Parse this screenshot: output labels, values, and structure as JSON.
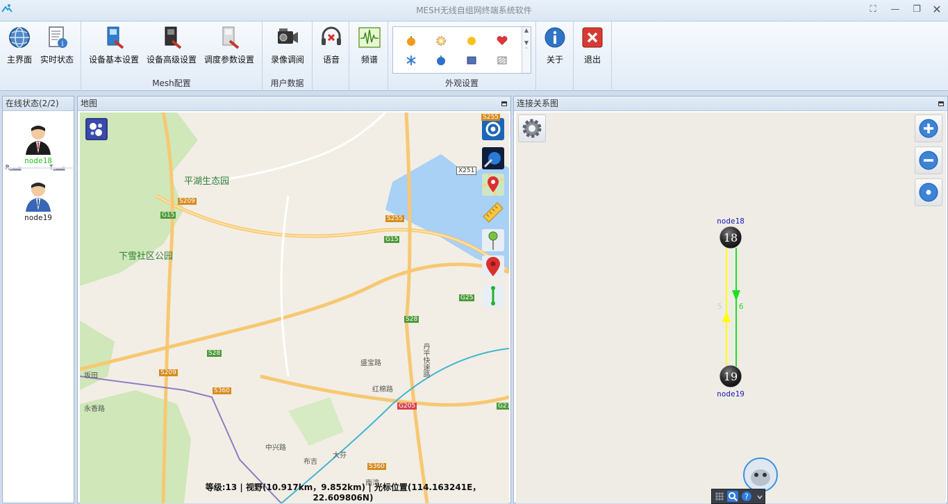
{
  "window": {
    "title": "MESH无线自组网终端系统软件"
  },
  "ribbon": {
    "groups": {
      "mesh_config": "Mesh配置",
      "user_data": "用户数据",
      "appearance": "外观设置"
    },
    "buttons": {
      "home": "主界面",
      "realtime": "实时状态",
      "basic_settings": "设备基本设置",
      "advanced_settings": "设备高级设置",
      "schedule_params": "调度参数设置",
      "recording": "录像调阅",
      "voice": "语音",
      "spectrum": "频谱",
      "about": "关于",
      "exit": "退出"
    }
  },
  "online_panel": {
    "title": "在线状态(2/2)",
    "nodes": [
      {
        "name": "node18",
        "color": "#22c322",
        "rx_label": "R",
        "tx_label": "T"
      },
      {
        "name": "node19",
        "color": "#111111"
      }
    ]
  },
  "map_panel": {
    "title": "地图",
    "status": "等级:13 | 视野(10.917km，9.852km) | 光标位置(114.163241E，22.609806N)",
    "labels": {
      "pinghu": "平湖生态园",
      "xiaxue": "下雪社区公园",
      "s209a": "S209",
      "s209b": "S209",
      "g15a": "G15",
      "g15b": "G15",
      "s255a": "S255",
      "s255b": "S255",
      "x251": "X251",
      "g25": "G25",
      "s28a": "S28",
      "s28b": "S28",
      "s360a": "S360",
      "s360b": "S360",
      "g205": "G205",
      "g21": "G21",
      "bantian": "坂田",
      "yongxiang": "永香路",
      "shengbao": "盛宝路",
      "hongmian": "红棉路",
      "zhongxing": "中兴路",
      "buji": "布吉",
      "dafen": "大芬",
      "nanwan": "南湾",
      "danping": "丹平快速路"
    }
  },
  "topology_panel": {
    "title": "连接关系图",
    "nodes": [
      {
        "id": "18",
        "name": "node18"
      },
      {
        "id": "19",
        "name": "node19"
      }
    ],
    "links": [
      {
        "from": "19",
        "to": "18",
        "value": "5",
        "color": "#ffff00"
      },
      {
        "from": "18",
        "to": "19",
        "value": "6",
        "color": "#22dd22"
      }
    ]
  },
  "colors": {
    "accent": "#4a7fc1",
    "node_up": "#22c322"
  }
}
